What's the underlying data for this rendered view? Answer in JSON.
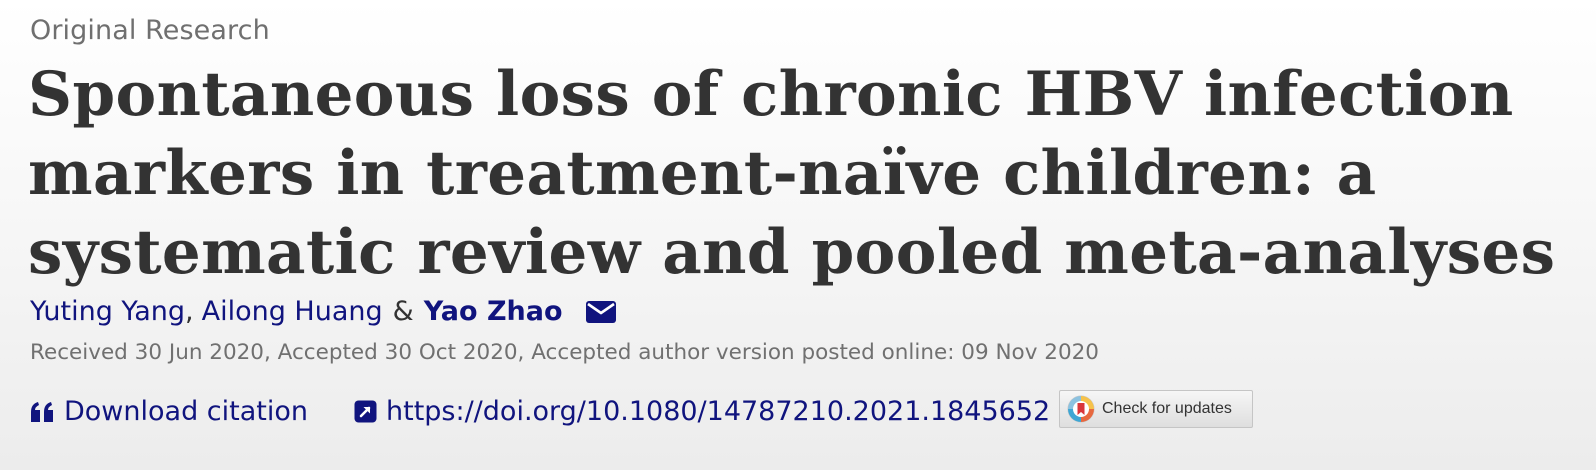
{
  "article_type": "Original Research",
  "title_lines": [
    "Spontaneous loss of chronic HBV infection",
    "markers in treatment-naïve children: a",
    "systematic review and pooled meta-analyses"
  ],
  "authors": [
    {
      "name": "Yuting Yang",
      "corresponding": false
    },
    {
      "name": "Ailong Huang",
      "corresponding": false
    },
    {
      "name": "Yao Zhao",
      "corresponding": true
    }
  ],
  "author_sep": ",",
  "author_amp": "&",
  "dates": "Received 30 Jun 2020, Accepted 30 Oct 2020, Accepted author version posted online: 09 Nov 2020",
  "links": {
    "download_citation": "Download citation",
    "doi": "https://doi.org/10.1080/14787210.2021.1845652"
  },
  "check_updates": "Check for updates",
  "icons": {
    "email": "envelope-icon",
    "citation": "quote-icon",
    "doi": "external-link-icon",
    "updates": "crossmark-icon"
  },
  "colors": {
    "link": "#10147e",
    "title": "#333333",
    "muted": "#707070"
  }
}
